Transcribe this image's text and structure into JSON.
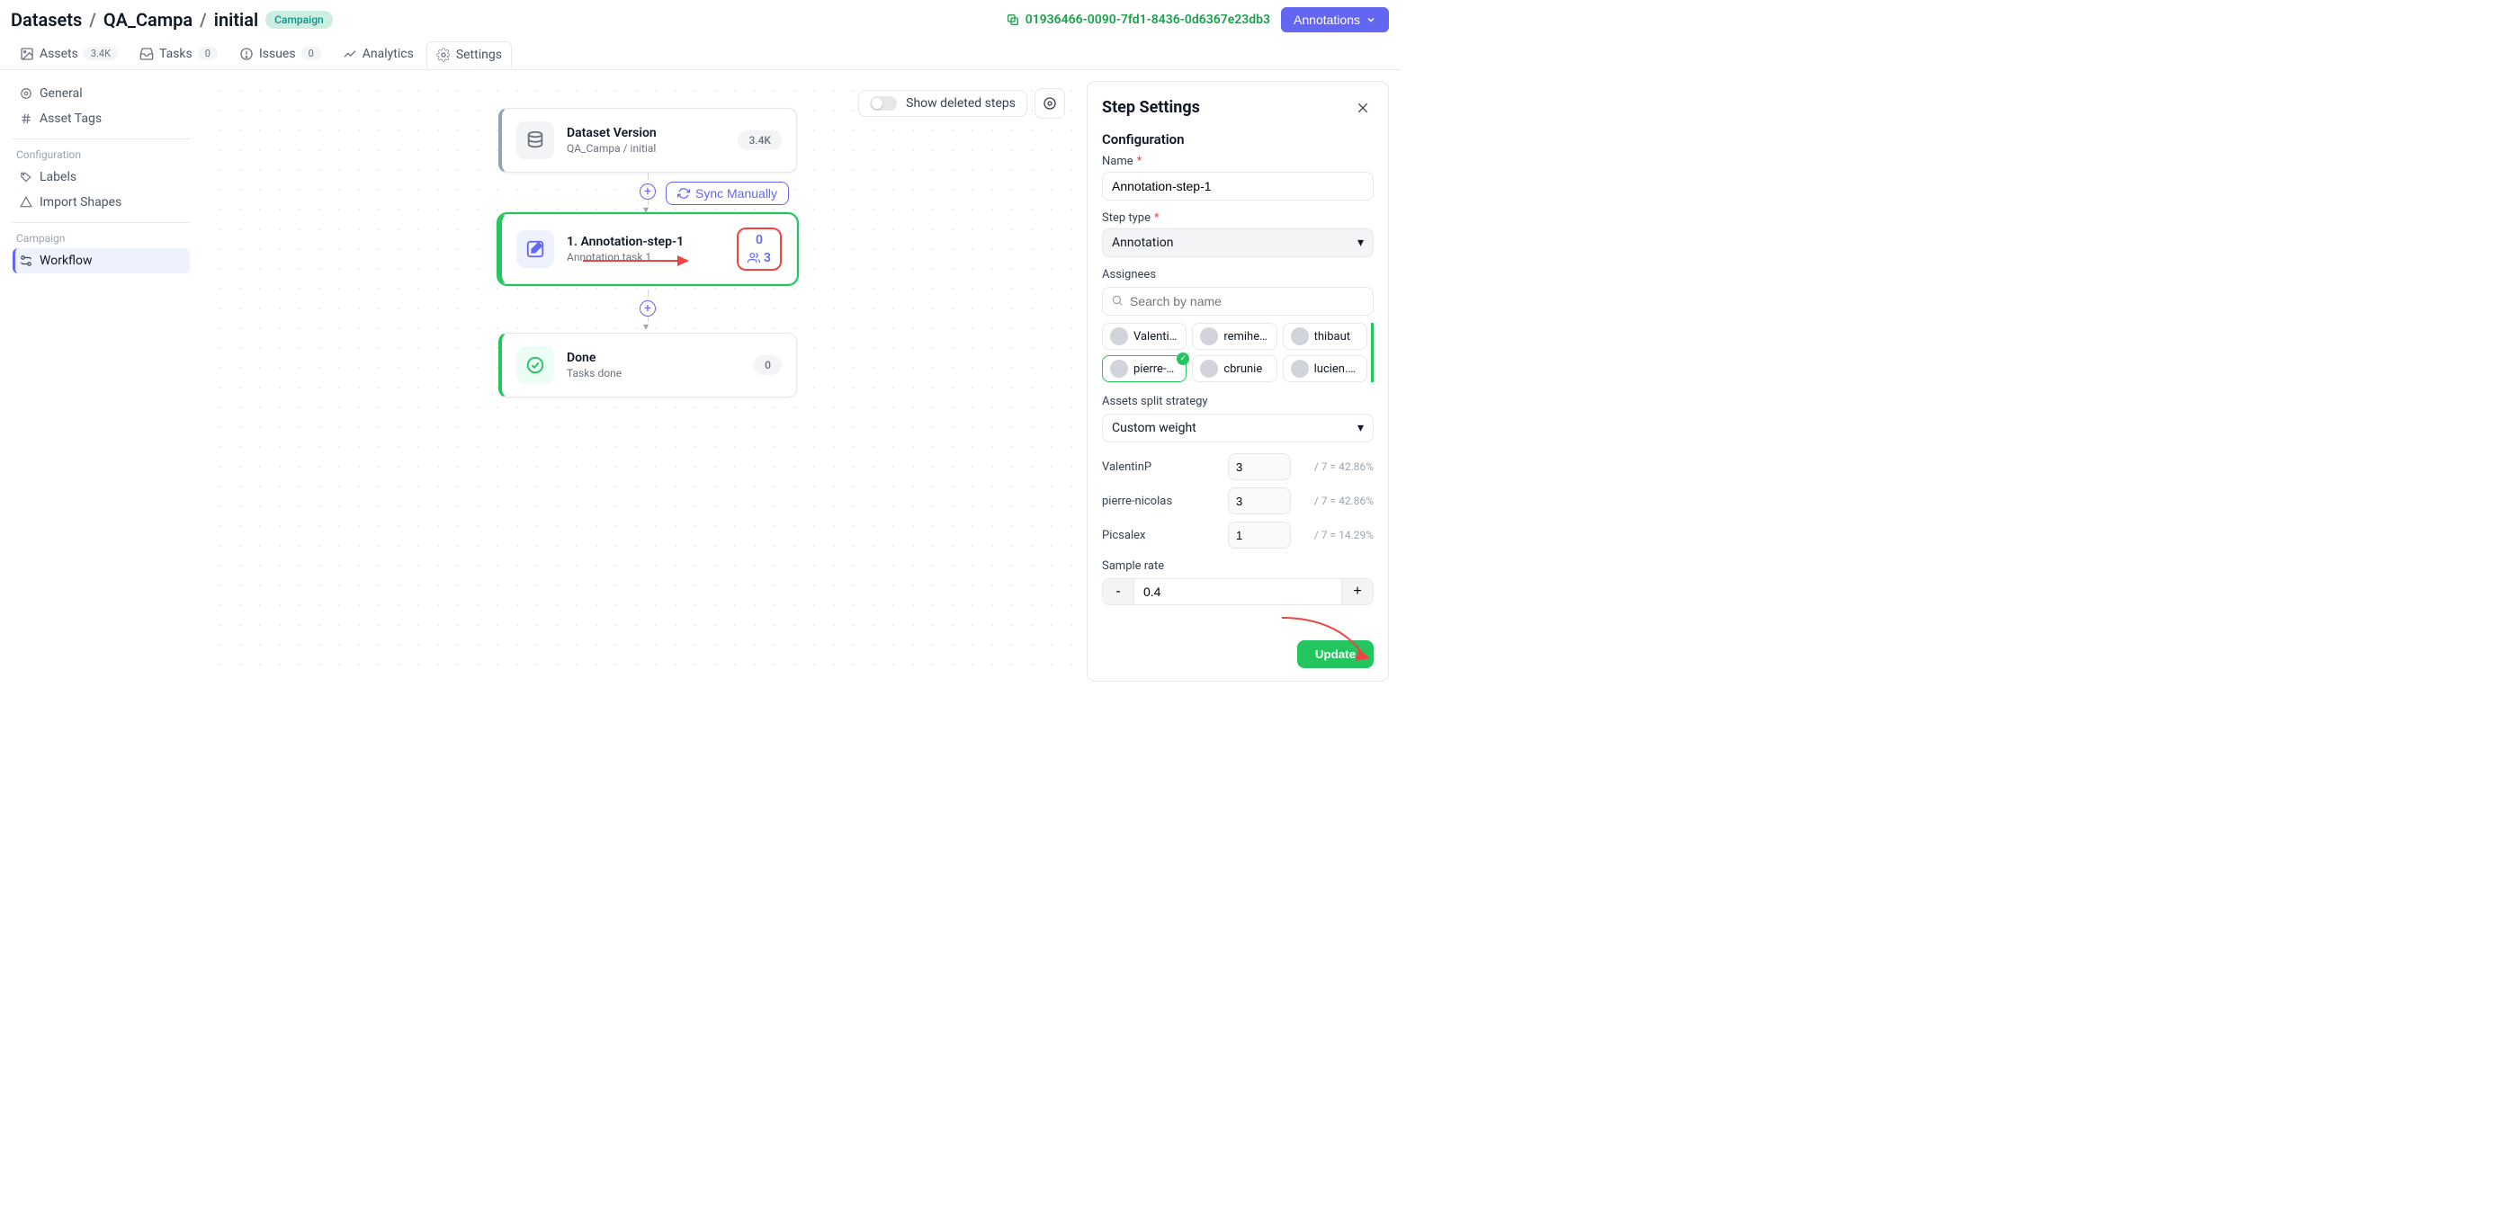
{
  "breadcrumb": {
    "root": "Datasets",
    "dataset": "QA_Campa",
    "version": "initial",
    "chip": "Campaign"
  },
  "uuid": "01936466-0090-7fd1-8436-0d6367e23db3",
  "annotations_btn": "Annotations",
  "tabs": {
    "assets": {
      "label": "Assets",
      "badge": "3.4K"
    },
    "tasks": {
      "label": "Tasks",
      "badge": "0"
    },
    "issues": {
      "label": "Issues",
      "badge": "0"
    },
    "analytics": {
      "label": "Analytics"
    },
    "settings": {
      "label": "Settings"
    }
  },
  "sidebar": {
    "general": "General",
    "asset_tags": "Asset Tags",
    "section_config": "Configuration",
    "labels": "Labels",
    "import_shapes": "Import Shapes",
    "section_campaign": "Campaign",
    "workflow": "Workflow"
  },
  "canvas": {
    "show_deleted": "Show deleted steps",
    "dataset_card": {
      "title": "Dataset Version",
      "subtitle": "QA_Campa / initial",
      "count": "3.4K"
    },
    "sync_btn": "Sync Manually",
    "step_card": {
      "title": "1. Annotation-step-1",
      "subtitle": "Annotation task 1",
      "metric_top": "0",
      "metric_bottom": "3"
    },
    "done_card": {
      "title": "Done",
      "subtitle": "Tasks done",
      "count": "0"
    }
  },
  "panel": {
    "title": "Step Settings",
    "section_config": "Configuration",
    "name_label": "Name",
    "name_value": "Annotation-step-1",
    "step_type_label": "Step type",
    "step_type_value": "Annotation",
    "assignees_label": "Assignees",
    "search_placeholder": "Search by name",
    "assignees": [
      {
        "name": "Valenti…",
        "selected": false
      },
      {
        "name": "remihe…",
        "selected": false
      },
      {
        "name": "thibaut",
        "selected": false
      },
      {
        "name": "pierre-…",
        "selected": true
      },
      {
        "name": "cbrunie",
        "selected": false
      },
      {
        "name": "lucien.…",
        "selected": false
      }
    ],
    "split_label": "Assets split strategy",
    "split_value": "Custom weight",
    "weights": [
      {
        "name": "ValentinP",
        "value": "3",
        "calc": "/ 7 = 42.86%"
      },
      {
        "name": "pierre-nicolas",
        "value": "3",
        "calc": "/ 7 = 42.86%"
      },
      {
        "name": "Picsalex",
        "value": "1",
        "calc": "/ 7 = 14.29%"
      }
    ],
    "sample_label": "Sample rate",
    "sample_value": "0.4",
    "update_btn": "Update"
  }
}
